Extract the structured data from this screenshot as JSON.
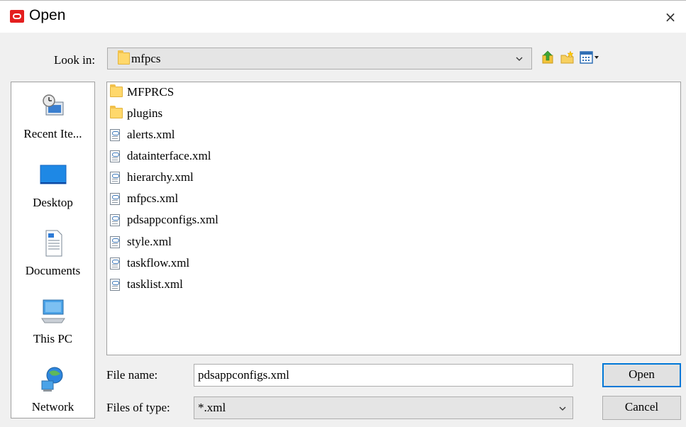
{
  "window": {
    "title": "Open",
    "close_glyph": "×"
  },
  "toolbar": {
    "look_in_label": "Look in:",
    "look_in_value": "mfpcs",
    "icons": [
      "up-folder-icon",
      "new-folder-icon",
      "view-menu-icon"
    ]
  },
  "places": [
    {
      "label": "Recent Ite...",
      "icon": "recent-items-icon"
    },
    {
      "label": "Desktop",
      "icon": "desktop-icon"
    },
    {
      "label": "Documents",
      "icon": "documents-icon"
    },
    {
      "label": "This PC",
      "icon": "this-pc-icon"
    },
    {
      "label": "Network",
      "icon": "network-icon"
    }
  ],
  "files": [
    {
      "name": "MFPRCS",
      "type": "folder"
    },
    {
      "name": "plugins",
      "type": "folder"
    },
    {
      "name": "alerts.xml",
      "type": "xml"
    },
    {
      "name": "datainterface.xml",
      "type": "xml"
    },
    {
      "name": "hierarchy.xml",
      "type": "xml"
    },
    {
      "name": "mfpcs.xml",
      "type": "xml"
    },
    {
      "name": "pdsappconfigs.xml",
      "type": "xml"
    },
    {
      "name": "style.xml",
      "type": "xml"
    },
    {
      "name": "taskflow.xml",
      "type": "xml"
    },
    {
      "name": "tasklist.xml",
      "type": "xml"
    }
  ],
  "form": {
    "file_name_label": "File name:",
    "file_name_value": "pdsappconfigs.xml",
    "file_type_label": "Files of type:",
    "file_type_value": "*.xml"
  },
  "buttons": {
    "open": "Open",
    "cancel": "Cancel"
  },
  "colors": {
    "accent": "#0078d7",
    "brand": "#e41f1f",
    "folder": "#ffd86b"
  }
}
